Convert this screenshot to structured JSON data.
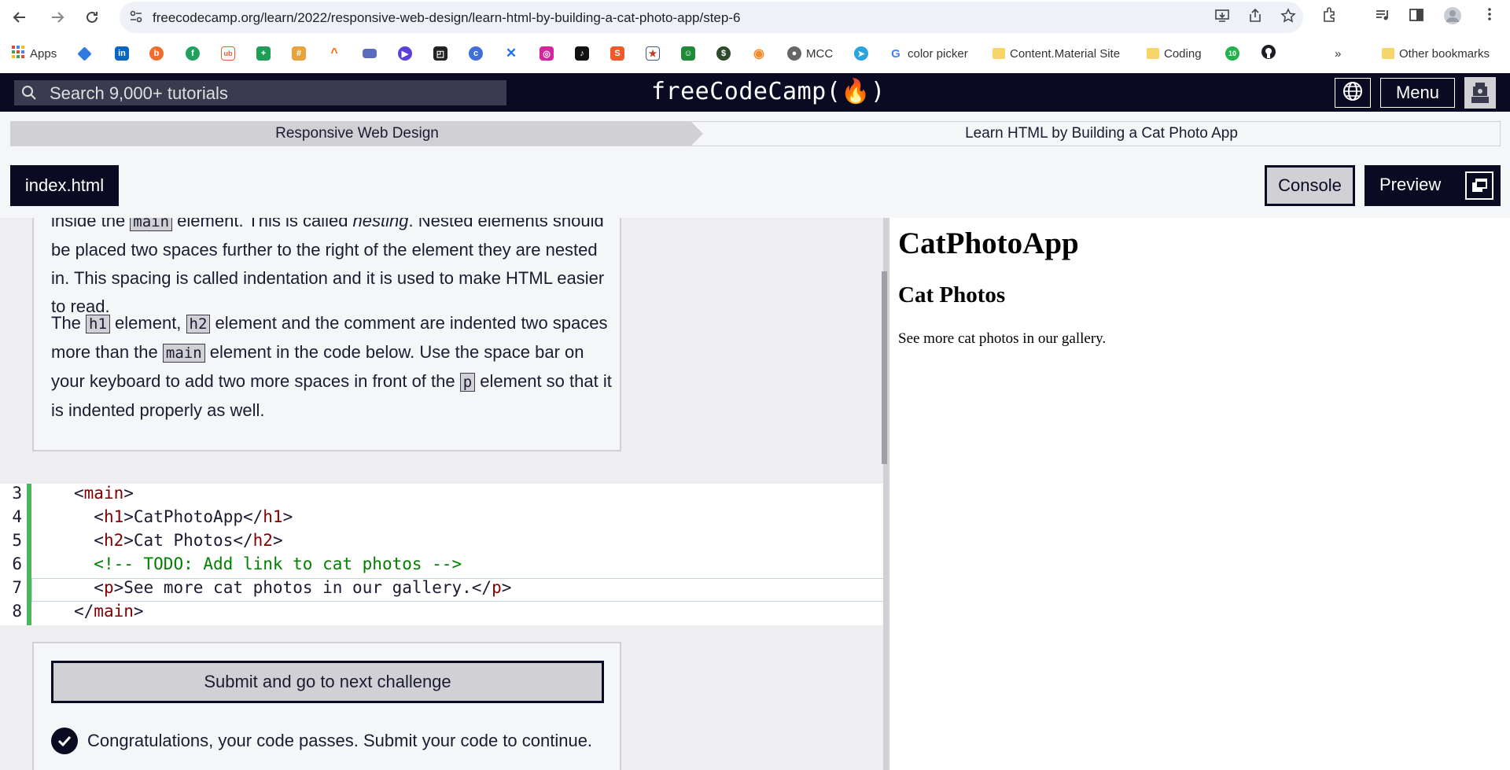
{
  "browser": {
    "url": "freecodecamp.org/learn/2022/responsive-web-design/learn-html-by-building-a-cat-photo-app/step-6",
    "bookmarks": {
      "apps": "Apps",
      "mcc": "MCC",
      "color_picker": "color picker",
      "content_material": "Content.Material Site",
      "coding": "Coding",
      "badge_count": "10",
      "overflow": "»",
      "other": "Other bookmarks"
    }
  },
  "nav": {
    "search_placeholder": "Search 9,000+ tutorials",
    "brand": "freeCodeCamp(🔥)",
    "menu_label": "Menu"
  },
  "breadcrumb": {
    "superblock": "Responsive Web Design",
    "block": "Learn HTML by Building a Cat Photo App"
  },
  "toolbar": {
    "file_tab": "index.html",
    "console_label": "Console",
    "preview_label": "Preview"
  },
  "description": {
    "p1_a": "inside the ",
    "p1_code": "main",
    "p1_b": " element. This is called ",
    "p1_em": "nesting",
    "p1_c": ". Nested elements should be placed two spaces further to the right of the element they are nested in. This spacing is called indentation and it is used to make HTML easier to read.",
    "p2_a": "The ",
    "p2_code1": "h1",
    "p2_b": " element, ",
    "p2_code2": "h2",
    "p2_c": " element and the comment are indented two spaces more than the ",
    "p2_code3": "main",
    "p2_d": " element in the code below. Use the space bar on your keyboard to add two more spaces in front of the ",
    "p2_code4": "p",
    "p2_e": " element so that it is indented properly as well."
  },
  "editor": {
    "line_numbers": [
      "3",
      "4",
      "5",
      "6",
      "7",
      "8"
    ],
    "lines": [
      {
        "indent": "",
        "open": "main",
        "text": "",
        "close": ""
      },
      {
        "indent": "  ",
        "open": "h1",
        "text": "CatPhotoApp",
        "close": "h1"
      },
      {
        "indent": "  ",
        "open": "h2",
        "text": "Cat Photos",
        "close": "h2"
      },
      {
        "indent": "  ",
        "comment": "<!-- TODO: Add link to cat photos -->"
      },
      {
        "indent": "  ",
        "open": "p",
        "text": "See more cat photos in our gallery.",
        "close": "p"
      },
      {
        "indent": "",
        "open": "",
        "text": "",
        "close": "main"
      }
    ]
  },
  "submit": {
    "button_label": "Submit and go to next challenge",
    "pass_message": "Congratulations, your code passes. Submit your code to continue."
  },
  "preview": {
    "h1": "CatPhotoApp",
    "h2": "Cat Photos",
    "p": "See more cat photos in our gallery."
  },
  "colors": {
    "fcc_dark": "#0a0a23",
    "gray": "#d0d0d5",
    "success_green": "#4fb45f",
    "tag_color": "#800000",
    "comment_color": "#008000"
  }
}
